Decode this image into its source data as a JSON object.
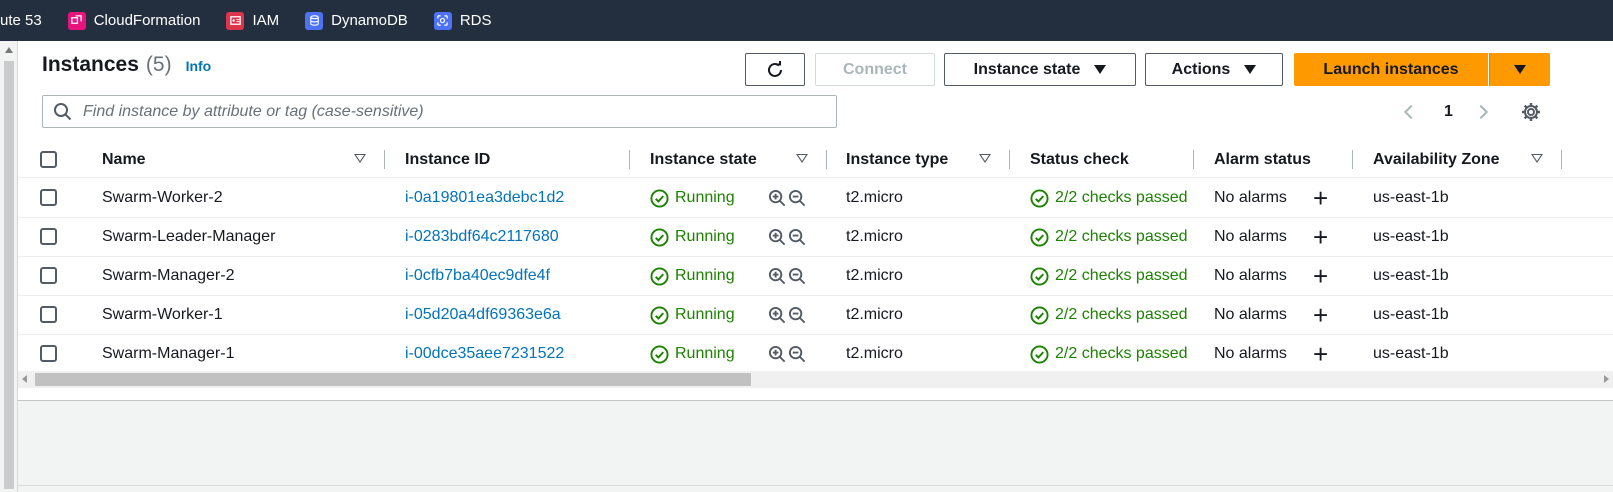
{
  "nav": {
    "favorites": [
      {
        "label": "ute 53",
        "icon": "route53-icon"
      },
      {
        "label": "CloudFormation",
        "icon": "cloudformation-icon",
        "color": "#e7157b"
      },
      {
        "label": "IAM",
        "icon": "iam-icon",
        "color": "#dd344c"
      },
      {
        "label": "DynamoDB",
        "icon": "dynamodb-icon",
        "color": "#4d72f3"
      },
      {
        "label": "RDS",
        "icon": "rds-icon",
        "color": "#4d72f3"
      }
    ]
  },
  "header": {
    "title": "Instances",
    "count": "(5)",
    "info": "Info"
  },
  "toolbar": {
    "refresh_icon": "refresh-icon",
    "connect": "Connect",
    "instance_state": "Instance state",
    "actions": "Actions",
    "launch": "Launch instances"
  },
  "search": {
    "placeholder": "Find instance by attribute or tag (case-sensitive)",
    "value": ""
  },
  "pagination": {
    "page": "1"
  },
  "table": {
    "columns": [
      "Name",
      "Instance ID",
      "Instance state",
      "Instance type",
      "Status check",
      "Alarm status",
      "Availability Zone"
    ],
    "rows": [
      {
        "name": "Swarm-Worker-2",
        "id": "i-0a19801ea3debc1d2",
        "state": "Running",
        "type": "t2.micro",
        "status": "2/2 checks passed",
        "alarm": "No alarms",
        "zone": "us-east-1b"
      },
      {
        "name": "Swarm-Leader-Manager",
        "id": "i-0283bdf64c2117680",
        "state": "Running",
        "type": "t2.micro",
        "status": "2/2 checks passed",
        "alarm": "No alarms",
        "zone": "us-east-1b"
      },
      {
        "name": "Swarm-Manager-2",
        "id": "i-0cfb7ba40ec9dfe4f",
        "state": "Running",
        "type": "t2.micro",
        "status": "2/2 checks passed",
        "alarm": "No alarms",
        "zone": "us-east-1b"
      },
      {
        "name": "Swarm-Worker-1",
        "id": "i-05d20a4df69363e6a",
        "state": "Running",
        "type": "t2.micro",
        "status": "2/2 checks passed",
        "alarm": "No alarms",
        "zone": "us-east-1b"
      },
      {
        "name": "Swarm-Manager-1",
        "id": "i-00dce35aee7231522",
        "state": "Running",
        "type": "t2.micro",
        "status": "2/2 checks passed",
        "alarm": "No alarms",
        "zone": "us-east-1b"
      }
    ]
  },
  "colors": {
    "nav_bg": "#232f3e",
    "link": "#0073bb",
    "success": "#1d8102",
    "primary": "#ff9900"
  }
}
